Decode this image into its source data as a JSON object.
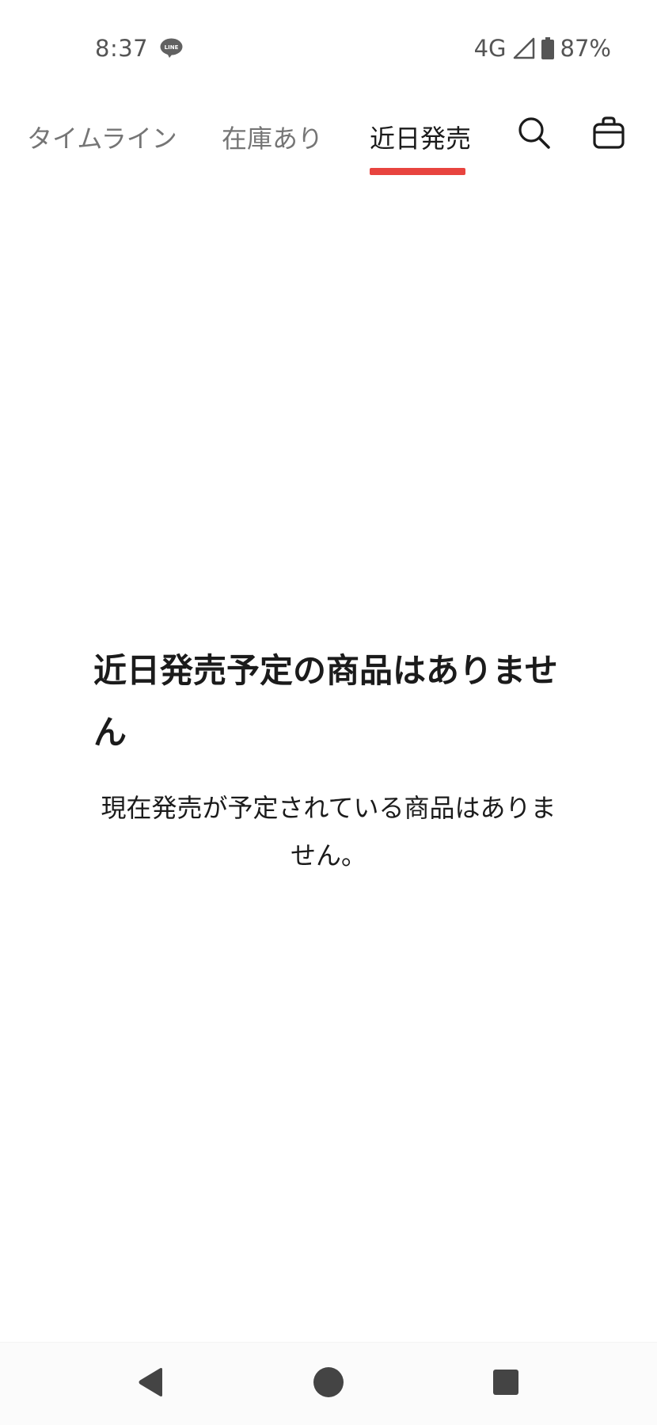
{
  "status_bar": {
    "time": "8:37",
    "notification_icon": "line-app-icon",
    "network": "4G",
    "signal_icon": "signal-icon",
    "battery_icon": "battery-icon",
    "battery_percent": "87%"
  },
  "tabs": [
    {
      "label": "タイムライン",
      "active": false
    },
    {
      "label": "在庫あり",
      "active": false
    },
    {
      "label": "近日発売",
      "active": true
    }
  ],
  "header_icons": {
    "search": "search-icon",
    "cart": "shopping-bag-icon"
  },
  "colors": {
    "accent": "#e8443f",
    "text_primary": "#1b1b1b",
    "text_secondary": "#757575"
  },
  "empty_state": {
    "title": "近日発売予定の商品はありません",
    "description": "現在発売が予定されている商品はありません。"
  },
  "nav_bar": {
    "back_icon": "back-triangle-icon",
    "home_icon": "home-circle-icon",
    "recents_icon": "recents-square-icon"
  }
}
